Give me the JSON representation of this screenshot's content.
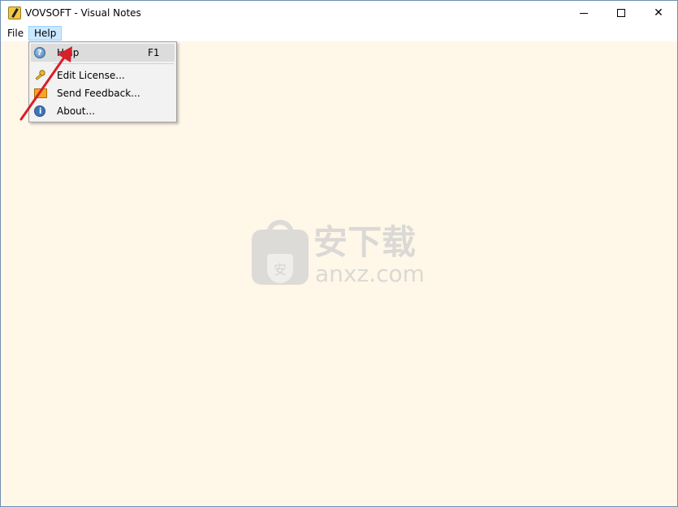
{
  "window": {
    "title": "VOVSOFT - Visual Notes",
    "close_glyph": "✕"
  },
  "menubar": {
    "file_label": "File",
    "help_label": "Help"
  },
  "help_menu": {
    "items": [
      {
        "label": "Help",
        "shortcut": "F1",
        "icon": "help-icon"
      },
      {
        "label": "Edit License...",
        "icon": "key-icon"
      },
      {
        "label": "Send Feedback...",
        "icon": "mail-icon"
      },
      {
        "label": "About...",
        "icon": "info-icon"
      }
    ]
  },
  "watermark": {
    "badge_char": "安",
    "cn_text": "安下载",
    "en_text": "anxz.com"
  },
  "colors": {
    "content_bg": "#fff7e8",
    "menu_highlight": "#cce8ff",
    "arrow": "#d6202a"
  }
}
